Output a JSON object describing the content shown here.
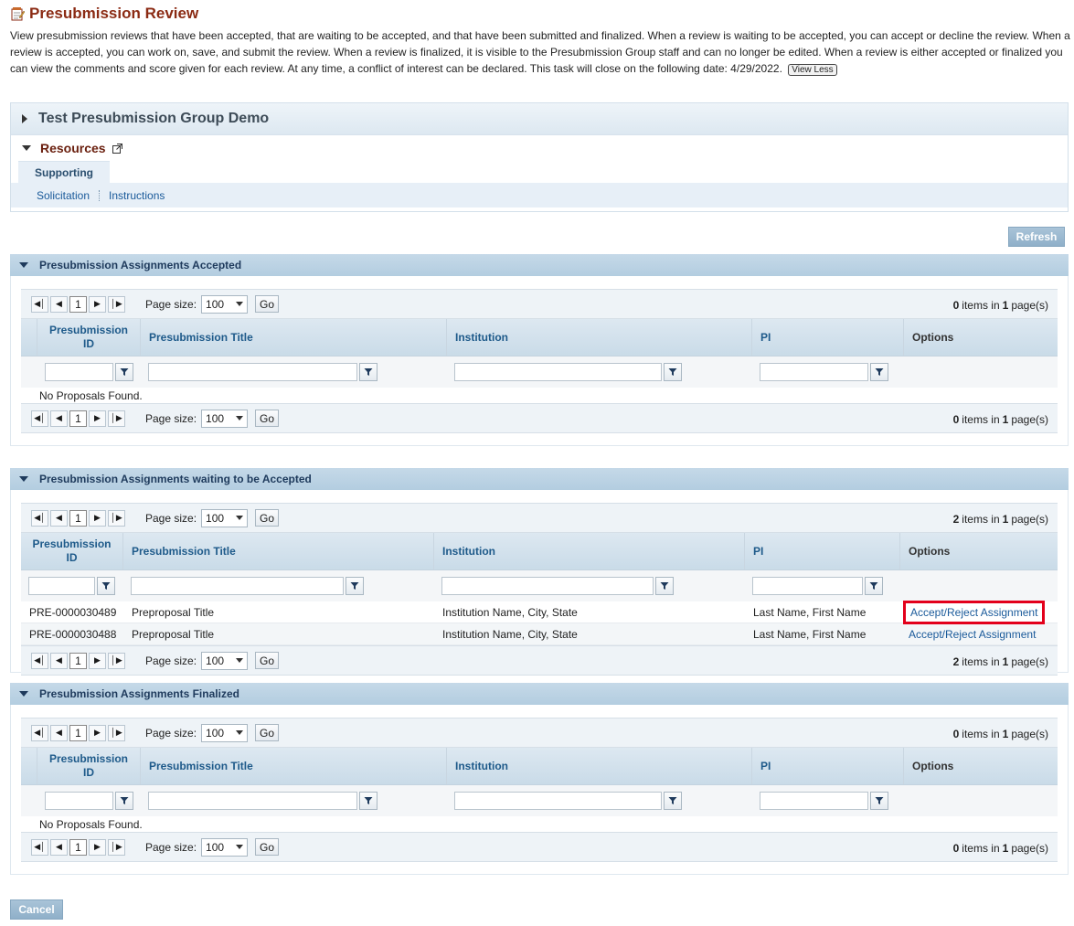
{
  "page": {
    "title": "Presubmission Review",
    "intro": "View presubmission reviews that have been accepted, that are waiting to be accepted, and that have been submitted and finalized. When a review is waiting to be accepted, you can accept or decline the review. When a review is accepted, you can work on, save, and submit the review. When a review is finalized, it is visible to the Presubmission Group staff and can no longer be edited. When a review is either accepted or finalized you can view the comments and score given for each review. At any time, a conflict of interest can be declared. This task will close on the following date: 4/29/2022.",
    "view_less": "View Less"
  },
  "group": {
    "title": "Test Presubmission Group Demo",
    "resources_label": "Resources",
    "tab_supporting": "Supporting",
    "links": [
      "Solicitation",
      "Instructions"
    ]
  },
  "buttons": {
    "refresh": "Refresh",
    "cancel": "Cancel",
    "go": "Go"
  },
  "pager": {
    "page_size_label": "Page size:",
    "page_size_value": "100",
    "current_page": "1",
    "items_suffix": "items in",
    "pages_suffix": "page(s)"
  },
  "columns": {
    "id_line1": "Presubmission",
    "id_line2": "ID",
    "title": "Presubmission Title",
    "institution": "Institution",
    "pi": "PI",
    "options": "Options"
  },
  "sections": {
    "accepted": {
      "title": "Presubmission Assignments Accepted",
      "items": "0",
      "pages": "1",
      "empty": "No Proposals Found."
    },
    "waiting": {
      "title": "Presubmission Assignments waiting to be Accepted",
      "items": "2",
      "pages": "1",
      "rows": [
        {
          "id": "PRE-0000030489",
          "title": "Preproposal Title",
          "institution": "Institution Name, City, State",
          "pi": "Last Name, First Name",
          "option": "Accept/Reject Assignment"
        },
        {
          "id": "PRE-0000030488",
          "title": "Preproposal Title",
          "institution": "Institution Name, City, State",
          "pi": "Last Name, First Name",
          "option": "Accept/Reject Assignment"
        }
      ]
    },
    "finalized": {
      "title": "Presubmission Assignments Finalized",
      "items": "0",
      "pages": "1",
      "empty": "No Proposals Found."
    }
  },
  "colors": {
    "title": "#8b2b14",
    "link": "#1a5a9a",
    "highlight": "#e3001b",
    "section_header": "#b3cde0"
  }
}
